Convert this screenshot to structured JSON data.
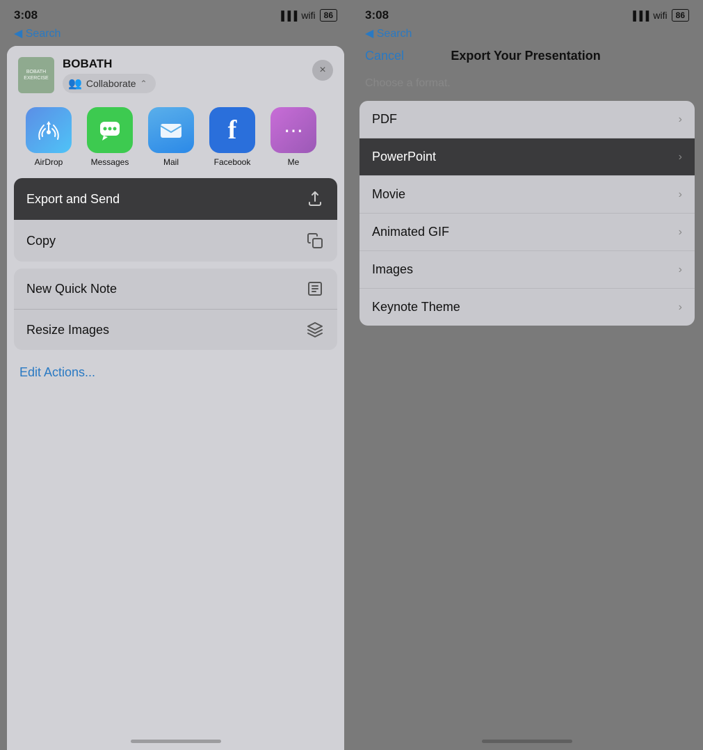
{
  "left": {
    "status": {
      "time": "3:08",
      "back_label": "◀ Search",
      "battery": "86"
    },
    "share_sheet": {
      "doc_name": "BOBATH",
      "doc_thumbnail_text": "BOBATH EXERCISE",
      "collaborate_label": "Collaborate",
      "close_icon": "×",
      "apps": [
        {
          "id": "airdrop",
          "label": "AirDrop"
        },
        {
          "id": "messages",
          "label": "Messages"
        },
        {
          "id": "mail",
          "label": "Mail"
        },
        {
          "id": "facebook",
          "label": "Facebook"
        },
        {
          "id": "more",
          "label": "Me"
        }
      ],
      "actions": [
        {
          "label": "Export and Send",
          "icon": "share",
          "dark": true
        },
        {
          "label": "Copy",
          "icon": "copy",
          "dark": false
        }
      ],
      "secondary": [
        {
          "label": "New Quick Note",
          "icon": "note"
        },
        {
          "label": "Resize Images",
          "icon": "layers"
        }
      ],
      "edit_actions": "Edit Actions..."
    }
  },
  "right": {
    "status": {
      "time": "3:08",
      "back_label": "◀ Search",
      "battery": "86"
    },
    "export": {
      "cancel_label": "Cancel",
      "title": "Export Your Presentation",
      "hint": "Choose a format.",
      "formats": [
        {
          "label": "PDF",
          "selected": false
        },
        {
          "label": "PowerPoint",
          "selected": true
        },
        {
          "label": "Movie",
          "selected": false
        },
        {
          "label": "Animated GIF",
          "selected": false
        },
        {
          "label": "Images",
          "selected": false
        },
        {
          "label": "Keynote Theme",
          "selected": false
        }
      ]
    }
  }
}
